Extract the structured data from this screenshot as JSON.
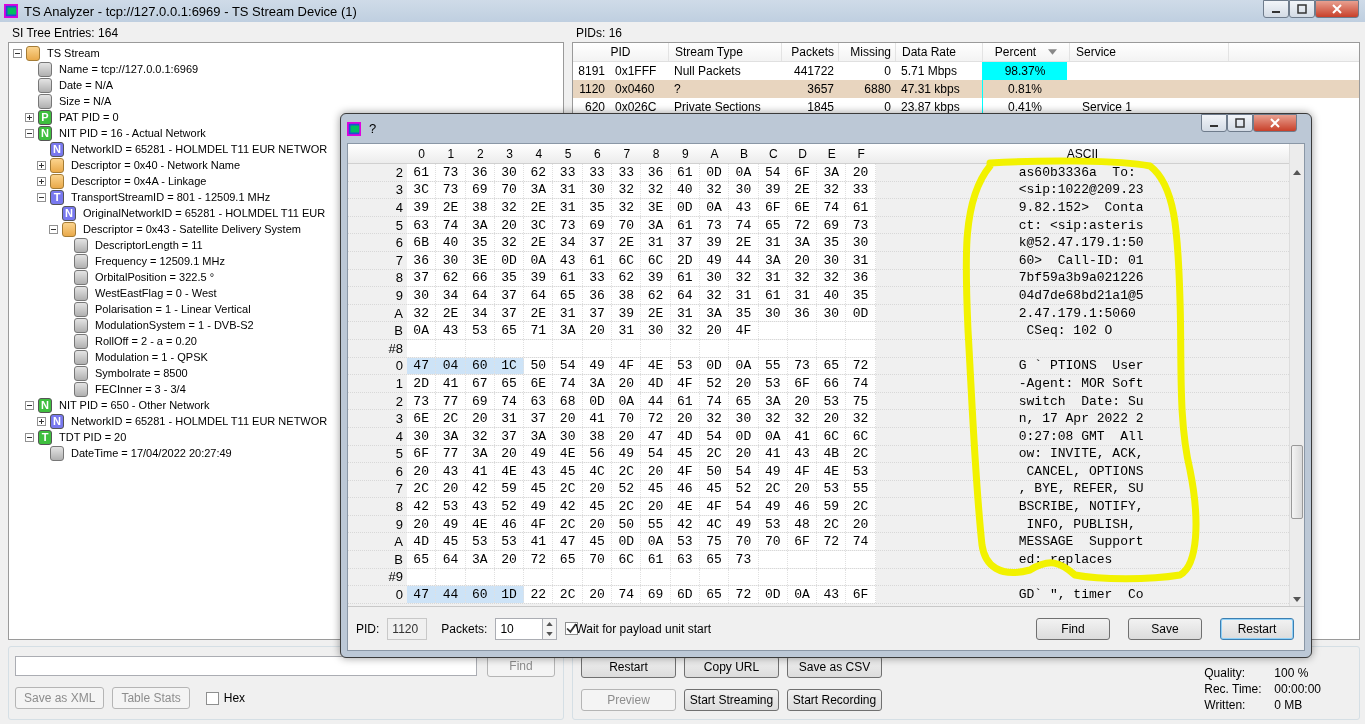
{
  "window": {
    "title": "TS Analyzer - tcp://127.0.0.1:6969 - TS Stream Device (1)"
  },
  "tree": {
    "title": "SI Tree Entries: 164",
    "items": [
      {
        "label": "TS Stream",
        "kind": "folder",
        "expanded": true,
        "children": [
          {
            "label": "Name = tcp://127.0.0.1:6969",
            "kind": "value"
          },
          {
            "label": "Date = N/A",
            "kind": "value"
          },
          {
            "label": "Size = N/A",
            "kind": "value"
          },
          {
            "label": "PAT PID = 0",
            "kind": "letter",
            "letter": "P",
            "color": "#3fbf3f",
            "expanded": false
          },
          {
            "label": "NIT PID = 16 - Actual Network",
            "kind": "letter",
            "letter": "N",
            "color": "#3fbf3f",
            "expanded": true,
            "children": [
              {
                "label": "NetworkID = 65281 - HOLMDEL T11 EUR NETWOR",
                "kind": "letter",
                "letter": "N",
                "color": "#7878ee"
              },
              {
                "label": "Descriptor = 0x40 - Network Name",
                "kind": "folder",
                "expanded": false
              },
              {
                "label": "Descriptor = 0x4A - Linkage",
                "kind": "folder",
                "expanded": false
              },
              {
                "label": "TransportStreamID = 801 - 12509.1 MHz",
                "kind": "letter",
                "letter": "T",
                "color": "#7878ee",
                "expanded": true,
                "children": [
                  {
                    "label": "OriginalNetworkID = 65281 - HOLMDEL T11 EUR",
                    "kind": "letter",
                    "letter": "N",
                    "color": "#7878ee"
                  },
                  {
                    "label": "Descriptor = 0x43 - Satellite Delivery System",
                    "kind": "folder",
                    "expanded": true,
                    "children": [
                      {
                        "label": "DescriptorLength = 11",
                        "kind": "value"
                      },
                      {
                        "label": "Frequency = 12509.1 MHz",
                        "kind": "value"
                      },
                      {
                        "label": "OrbitalPosition = 322.5 °",
                        "kind": "value"
                      },
                      {
                        "label": "WestEastFlag = 0 - West",
                        "kind": "value"
                      },
                      {
                        "label": "Polarisation = 1 - Linear Vertical",
                        "kind": "value"
                      },
                      {
                        "label": "ModulationSystem = 1 - DVB-S2",
                        "kind": "value"
                      },
                      {
                        "label": "RollOff = 2 - a = 0.20",
                        "kind": "value"
                      },
                      {
                        "label": "Modulation = 1 - QPSK",
                        "kind": "value"
                      },
                      {
                        "label": "Symbolrate = 8500",
                        "kind": "value"
                      },
                      {
                        "label": "FECInner = 3 - 3/4",
                        "kind": "value"
                      }
                    ]
                  }
                ]
              }
            ]
          },
          {
            "label": "NIT PID = 650 - Other Network",
            "kind": "letter",
            "letter": "N",
            "color": "#3fbf3f",
            "expanded": true,
            "children": [
              {
                "label": "NetworkID = 65281 - HOLMDEL T11 EUR NETWOR",
                "kind": "letter",
                "letter": "N",
                "color": "#7878ee",
                "expanded": false
              }
            ]
          },
          {
            "label": "TDT PID = 20",
            "kind": "letter",
            "letter": "T",
            "color": "#3fbf3f",
            "expanded": true,
            "children": [
              {
                "label": "DateTime = 17/04/2022 20:27:49",
                "kind": "value"
              }
            ]
          }
        ]
      }
    ]
  },
  "pids": {
    "title": "PIDs: 16",
    "columns": [
      {
        "label": "PID",
        "sorted": false
      },
      {
        "label": "Stream Type",
        "sorted": false
      },
      {
        "label": "Packets",
        "sorted": false
      },
      {
        "label": "Missing",
        "sorted": false
      },
      {
        "label": "Data Rate",
        "sorted": false
      },
      {
        "label": "Percent",
        "sorted": true
      },
      {
        "label": "Service",
        "sorted": false
      }
    ],
    "rows": [
      {
        "pid": "8191",
        "pid_hex": "0x1FFF",
        "stream_type": "Null Packets",
        "packets": "441722",
        "missing": "0",
        "data_rate": "5.71 Mbps",
        "percent": "98.37%",
        "selected": false
      },
      {
        "pid": "1120",
        "pid_hex": "0x0460",
        "stream_type": "?",
        "packets": "3657",
        "missing": "6880",
        "data_rate": "47.31 kbps",
        "percent": "0.81%",
        "selected": true
      },
      {
        "pid": "620",
        "pid_hex": "0x026C",
        "stream_type": "Private Sections",
        "packets": "1845",
        "missing": "0",
        "data_rate": "23.87 kbps",
        "percent": "0.41%",
        "service": "Service 1",
        "selected": false
      }
    ]
  },
  "search": {
    "find": {
      "label": "Find",
      "disabled": true
    },
    "buttons": [
      {
        "label": "Save as XML",
        "disabled": true
      },
      {
        "label": "Table Stats",
        "disabled": true
      }
    ],
    "hex": {
      "label": "Hex",
      "checked": false
    }
  },
  "controls": {
    "rows": [
      [
        {
          "label": "Restart",
          "disabled": false
        },
        {
          "label": "Copy URL",
          "disabled": false
        },
        {
          "label": "Save as CSV",
          "disabled": false
        }
      ],
      [
        {
          "label": "Preview",
          "disabled": true
        },
        {
          "label": "Start Streaming",
          "disabled": false
        },
        {
          "label": "Start Recording",
          "disabled": false
        }
      ]
    ],
    "stats": [
      {
        "label": "Quality:",
        "value": "100 %"
      },
      {
        "label": "Rec. Time:",
        "value": "00:00:00"
      },
      {
        "label": "Written:",
        "value": "0 MB"
      }
    ]
  },
  "dialog": {
    "title": "?",
    "columns": [
      "0",
      "1",
      "2",
      "3",
      "4",
      "5",
      "6",
      "7",
      "8",
      "9",
      "A",
      "B",
      "C",
      "D",
      "E",
      "F"
    ],
    "ascii_header": "ASCII",
    "rows": [
      {
        "kind": "data",
        "label": "2",
        "sync": false,
        "bytes": [
          "61",
          "73",
          "36",
          "30",
          "62",
          "33",
          "33",
          "33",
          "36",
          "61",
          "0D",
          "0A",
          "54",
          "6F",
          "3A",
          "20"
        ],
        "ascii": "as60b3336a  To:"
      },
      {
        "kind": "data",
        "label": "3",
        "sync": false,
        "bytes": [
          "3C",
          "73",
          "69",
          "70",
          "3A",
          "31",
          "30",
          "32",
          "32",
          "40",
          "32",
          "30",
          "39",
          "2E",
          "32",
          "33"
        ],
        "ascii": "<sip:1022@209.23"
      },
      {
        "kind": "data",
        "label": "4",
        "sync": false,
        "bytes": [
          "39",
          "2E",
          "38",
          "32",
          "2E",
          "31",
          "35",
          "32",
          "3E",
          "0D",
          "0A",
          "43",
          "6F",
          "6E",
          "74",
          "61"
        ],
        "ascii": "9.82.152>  Conta"
      },
      {
        "kind": "data",
        "label": "5",
        "sync": false,
        "bytes": [
          "63",
          "74",
          "3A",
          "20",
          "3C",
          "73",
          "69",
          "70",
          "3A",
          "61",
          "73",
          "74",
          "65",
          "72",
          "69",
          "73"
        ],
        "ascii": "ct: <sip:asteris"
      },
      {
        "kind": "data",
        "label": "6",
        "sync": false,
        "bytes": [
          "6B",
          "40",
          "35",
          "32",
          "2E",
          "34",
          "37",
          "2E",
          "31",
          "37",
          "39",
          "2E",
          "31",
          "3A",
          "35",
          "30"
        ],
        "ascii": "k@52.47.179.1:50"
      },
      {
        "kind": "data",
        "label": "7",
        "sync": false,
        "bytes": [
          "36",
          "30",
          "3E",
          "0D",
          "0A",
          "43",
          "61",
          "6C",
          "6C",
          "2D",
          "49",
          "44",
          "3A",
          "20",
          "30",
          "31"
        ],
        "ascii": "60>  Call-ID: 01"
      },
      {
        "kind": "data",
        "label": "8",
        "sync": false,
        "bytes": [
          "37",
          "62",
          "66",
          "35",
          "39",
          "61",
          "33",
          "62",
          "39",
          "61",
          "30",
          "32",
          "31",
          "32",
          "32",
          "36"
        ],
        "ascii": "7bf59a3b9a021226"
      },
      {
        "kind": "data",
        "label": "9",
        "sync": false,
        "bytes": [
          "30",
          "34",
          "64",
          "37",
          "64",
          "65",
          "36",
          "38",
          "62",
          "64",
          "32",
          "31",
          "61",
          "31",
          "40",
          "35"
        ],
        "ascii": "04d7de68bd21a1@5"
      },
      {
        "kind": "data",
        "label": "A",
        "sync": false,
        "bytes": [
          "32",
          "2E",
          "34",
          "37",
          "2E",
          "31",
          "37",
          "39",
          "2E",
          "31",
          "3A",
          "35",
          "30",
          "36",
          "30",
          "0D"
        ],
        "ascii": "2.47.179.1:5060"
      },
      {
        "kind": "data",
        "label": "B",
        "sync": false,
        "bytes": [
          "0A",
          "43",
          "53",
          "65",
          "71",
          "3A",
          "20",
          "31",
          "30",
          "32",
          "20",
          "4F"
        ],
        "ascii": " CSeq: 102 O"
      },
      {
        "kind": "packet",
        "label": "#8"
      },
      {
        "kind": "data",
        "label": "0",
        "sync": true,
        "bytes": [
          "47",
          "04",
          "60",
          "1C",
          "50",
          "54",
          "49",
          "4F",
          "4E",
          "53",
          "0D",
          "0A",
          "55",
          "73",
          "65",
          "72"
        ],
        "ascii": "G ` PTIONS  User"
      },
      {
        "kind": "data",
        "label": "1",
        "sync": false,
        "bytes": [
          "2D",
          "41",
          "67",
          "65",
          "6E",
          "74",
          "3A",
          "20",
          "4D",
          "4F",
          "52",
          "20",
          "53",
          "6F",
          "66",
          "74"
        ],
        "ascii": "-Agent: MOR Soft"
      },
      {
        "kind": "data",
        "label": "2",
        "sync": false,
        "bytes": [
          "73",
          "77",
          "69",
          "74",
          "63",
          "68",
          "0D",
          "0A",
          "44",
          "61",
          "74",
          "65",
          "3A",
          "20",
          "53",
          "75"
        ],
        "ascii": "switch  Date: Su"
      },
      {
        "kind": "data",
        "label": "3",
        "sync": false,
        "bytes": [
          "6E",
          "2C",
          "20",
          "31",
          "37",
          "20",
          "41",
          "70",
          "72",
          "20",
          "32",
          "30",
          "32",
          "32",
          "20",
          "32"
        ],
        "ascii": "n, 17 Apr 2022 2"
      },
      {
        "kind": "data",
        "label": "4",
        "sync": false,
        "bytes": [
          "30",
          "3A",
          "32",
          "37",
          "3A",
          "30",
          "38",
          "20",
          "47",
          "4D",
          "54",
          "0D",
          "0A",
          "41",
          "6C",
          "6C"
        ],
        "ascii": "0:27:08 GMT  All"
      },
      {
        "kind": "data",
        "label": "5",
        "sync": false,
        "bytes": [
          "6F",
          "77",
          "3A",
          "20",
          "49",
          "4E",
          "56",
          "49",
          "54",
          "45",
          "2C",
          "20",
          "41",
          "43",
          "4B",
          "2C"
        ],
        "ascii": "ow: INVITE, ACK,"
      },
      {
        "kind": "data",
        "label": "6",
        "sync": false,
        "bytes": [
          "20",
          "43",
          "41",
          "4E",
          "43",
          "45",
          "4C",
          "2C",
          "20",
          "4F",
          "50",
          "54",
          "49",
          "4F",
          "4E",
          "53"
        ],
        "ascii": " CANCEL, OPTIONS"
      },
      {
        "kind": "data",
        "label": "7",
        "sync": false,
        "bytes": [
          "2C",
          "20",
          "42",
          "59",
          "45",
          "2C",
          "20",
          "52",
          "45",
          "46",
          "45",
          "52",
          "2C",
          "20",
          "53",
          "55"
        ],
        "ascii": ", BYE, REFER, SU"
      },
      {
        "kind": "data",
        "label": "8",
        "sync": false,
        "bytes": [
          "42",
          "53",
          "43",
          "52",
          "49",
          "42",
          "45",
          "2C",
          "20",
          "4E",
          "4F",
          "54",
          "49",
          "46",
          "59",
          "2C"
        ],
        "ascii": "BSCRIBE, NOTIFY,"
      },
      {
        "kind": "data",
        "label": "9",
        "sync": false,
        "bytes": [
          "20",
          "49",
          "4E",
          "46",
          "4F",
          "2C",
          "20",
          "50",
          "55",
          "42",
          "4C",
          "49",
          "53",
          "48",
          "2C",
          "20"
        ],
        "ascii": " INFO, PUBLISH,"
      },
      {
        "kind": "data",
        "label": "A",
        "sync": false,
        "bytes": [
          "4D",
          "45",
          "53",
          "53",
          "41",
          "47",
          "45",
          "0D",
          "0A",
          "53",
          "75",
          "70",
          "70",
          "6F",
          "72",
          "74"
        ],
        "ascii": "MESSAGE  Support"
      },
      {
        "kind": "data",
        "label": "B",
        "sync": false,
        "bytes": [
          "65",
          "64",
          "3A",
          "20",
          "72",
          "65",
          "70",
          "6C",
          "61",
          "63",
          "65",
          "73"
        ],
        "ascii": "ed: replaces"
      },
      {
        "kind": "packet",
        "label": "#9"
      },
      {
        "kind": "data",
        "label": "0",
        "sync": true,
        "bytes": [
          "47",
          "44",
          "60",
          "1D",
          "22",
          "2C",
          "20",
          "74",
          "69",
          "6D",
          "65",
          "72",
          "0D",
          "0A",
          "43",
          "6F"
        ],
        "ascii": "GD` \", timer  Co"
      }
    ],
    "pid_label": "PID:",
    "pid": "1120",
    "packets_label": "Packets:",
    "packets": "10",
    "wait": {
      "label": "Wait for payload unit start",
      "checked": true
    },
    "buttons": [
      {
        "label": "Find",
        "default": false
      },
      {
        "label": "Save",
        "default": false
      },
      {
        "label": "Restart",
        "default": true
      }
    ]
  }
}
